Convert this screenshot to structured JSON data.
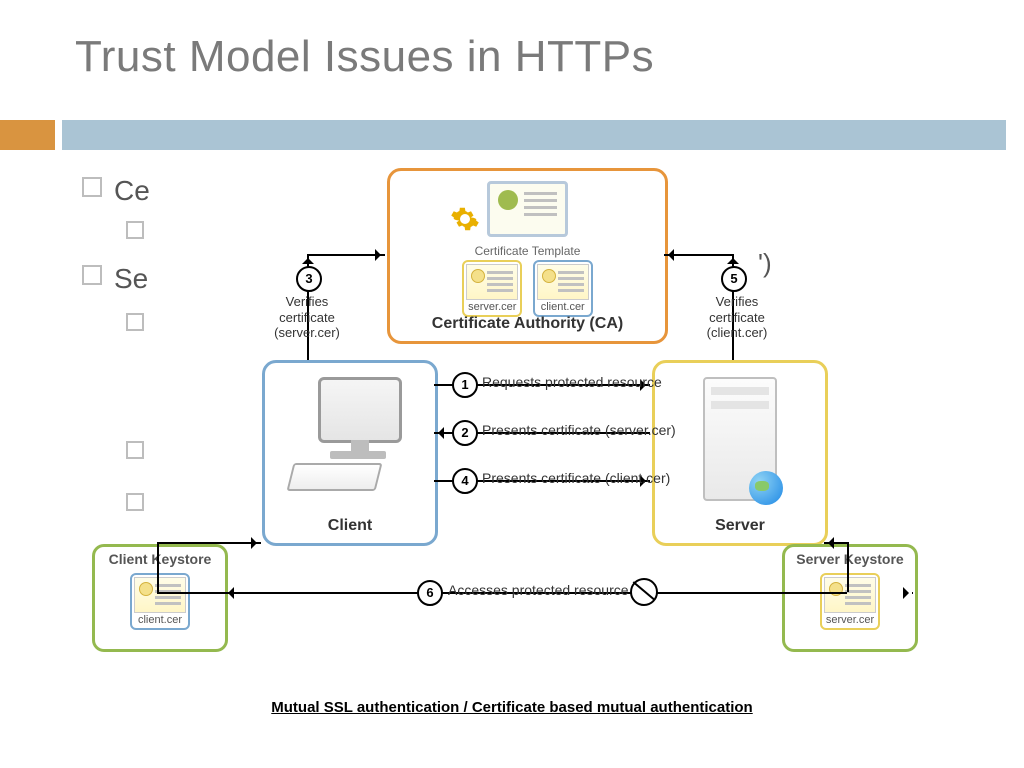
{
  "title": "Trust Model Issues in HTTPs",
  "bg_bullets": {
    "b1": "Ce",
    "b2": "Se",
    "tail": "')"
  },
  "ca": {
    "label": "Certificate Authority (CA)",
    "template_label": "Certificate Template",
    "cert1": "server.cer",
    "cert2": "client.cer"
  },
  "client": {
    "label": "Client"
  },
  "server": {
    "label": "Server"
  },
  "ks_left": {
    "title": "Client Keystore",
    "cert": "client.cer"
  },
  "ks_right": {
    "title": "Server Keystore",
    "cert": "server.cer"
  },
  "verify_left": {
    "badge": "3",
    "line1": "Verifies",
    "line2": "certificate",
    "line3": "(server.cer)"
  },
  "verify_right": {
    "badge": "5",
    "line1": "Verifies",
    "line2": "certificate",
    "line3": "(client.cer)"
  },
  "steps": {
    "s1": {
      "n": "1",
      "t": "Requests protected resource"
    },
    "s2": {
      "n": "2",
      "t": "Presents certificate (server.cer)"
    },
    "s4": {
      "n": "4",
      "t": "Presents certificate (client.cer)"
    },
    "s6": {
      "n": "6",
      "t": "Accesses protected resource"
    }
  },
  "caption": "Mutual SSL authentication / Certificate based mutual authentication"
}
